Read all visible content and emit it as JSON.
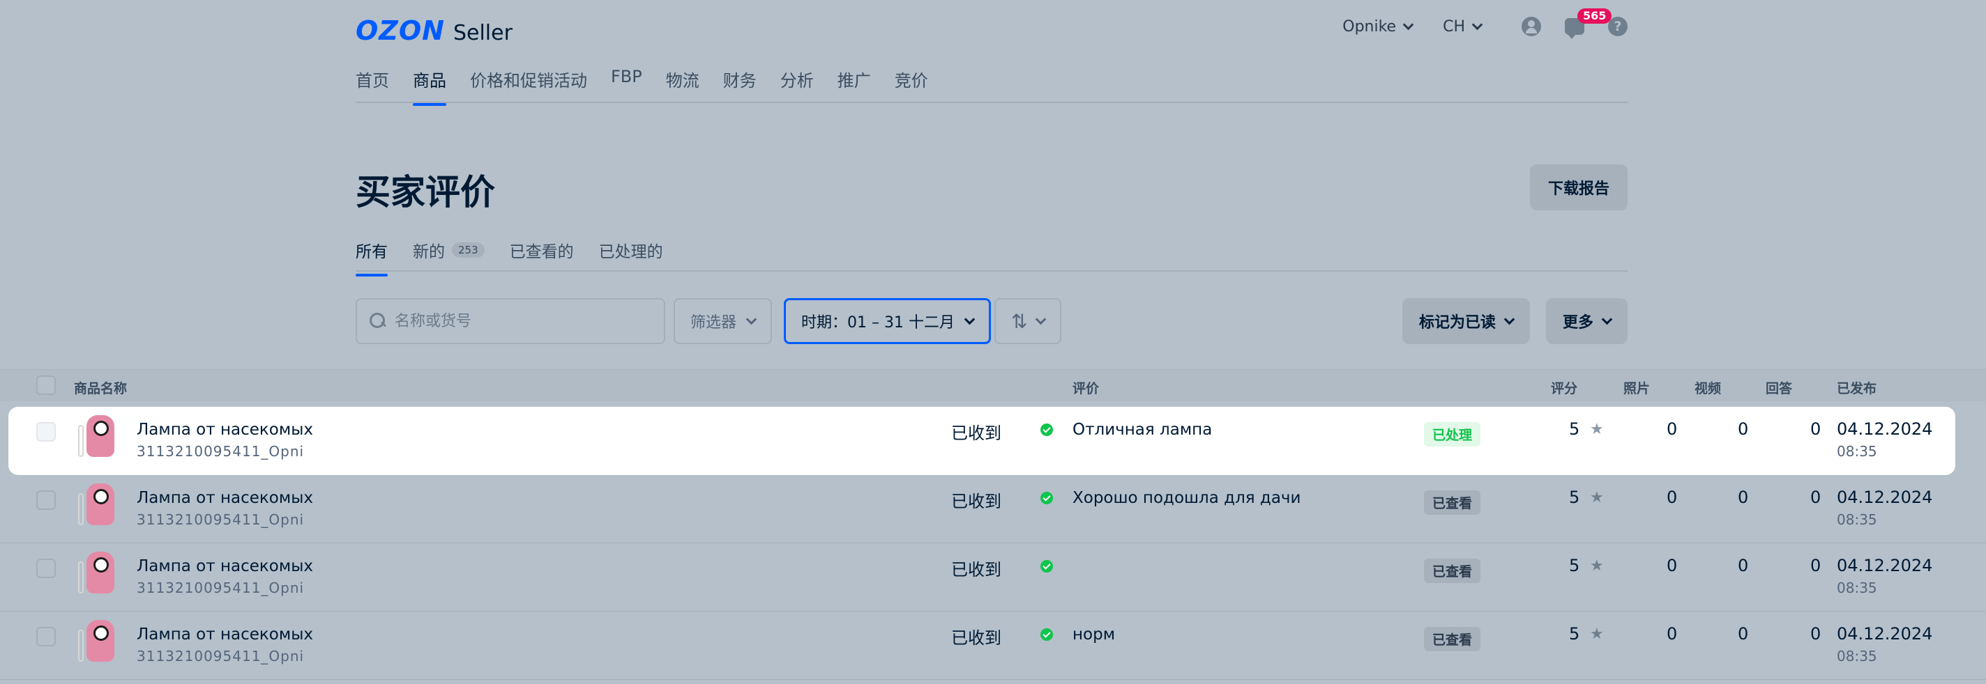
{
  "header": {
    "logo_brand": "OZON",
    "logo_product": "Seller",
    "account_label": "Opnike",
    "language_label": "CH",
    "notifications_count": "565",
    "nav": [
      "首页",
      "商品",
      "价格和促销活动",
      "FBP",
      "物流",
      "财务",
      "分析",
      "推广",
      "竞价"
    ],
    "nav_active": "商品"
  },
  "page": {
    "title": "买家评价",
    "download_button": "下载报告",
    "tabs": [
      {
        "label": "所有",
        "count": ""
      },
      {
        "label": "新的",
        "count": "253"
      },
      {
        "label": "已查看的",
        "count": ""
      },
      {
        "label": "已处理的",
        "count": ""
      }
    ]
  },
  "toolbar": {
    "search_placeholder": "名称或货号",
    "filter_label": "筛选器",
    "period_label": "时期：01 – 31 十二月",
    "mark_read_label": "标记为已读",
    "more_label": "更多"
  },
  "table": {
    "headers": {
      "product": "商品名称",
      "review": "评价",
      "rating": "评分",
      "photos": "照片",
      "videos": "视频",
      "replies": "回答",
      "published": "已发布"
    },
    "rows": [
      {
        "name": "Лампа от насекомых",
        "sku": "3113210095411_Opni",
        "received": "已收到",
        "review": "Отличная лампа",
        "status": "已处理",
        "rating": "5",
        "photos": "0",
        "videos": "0",
        "replies": "0",
        "date": "04.12.2024",
        "time": "08:35"
      },
      {
        "name": "Лампа от насекомых",
        "sku": "3113210095411_Opni",
        "received": "已收到",
        "review": "Хорошо подошла для дачи",
        "status": "已查看",
        "rating": "5",
        "photos": "0",
        "videos": "0",
        "replies": "0",
        "date": "04.12.2024",
        "time": "08:35"
      },
      {
        "name": "Лампа от насекомых",
        "sku": "3113210095411_Opni",
        "received": "已收到",
        "review": "",
        "status": "已查看",
        "rating": "5",
        "photos": "0",
        "videos": "0",
        "replies": "0",
        "date": "04.12.2024",
        "time": "08:35"
      },
      {
        "name": "Лампа от насекомых",
        "sku": "3113210095411_Opni",
        "received": "已收到",
        "review": "норм",
        "status": "已查看",
        "rating": "5",
        "photos": "0",
        "videos": "0",
        "replies": "0",
        "date": "04.12.2024",
        "time": "08:35"
      }
    ]
  },
  "colors": {
    "accent": "#005bff",
    "success": "#10c44c",
    "badge": "#e5115c"
  }
}
